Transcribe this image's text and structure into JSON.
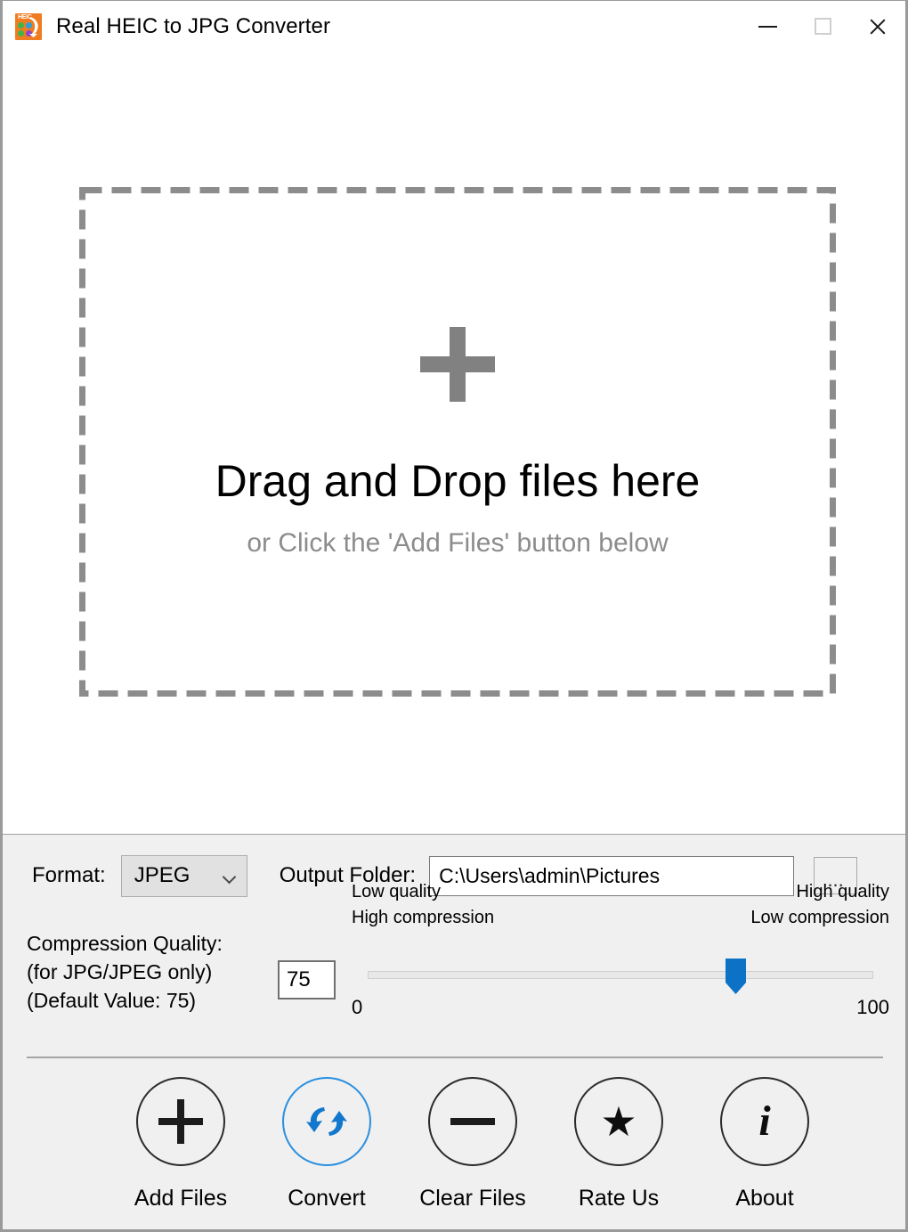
{
  "window": {
    "title": "Real HEIC to JPG Converter",
    "icon": "heic-app-icon",
    "icon_text": "HEIC",
    "controls": {
      "minimize": "minimize-icon",
      "maximize": "maximize-icon",
      "close": "close-icon"
    }
  },
  "dropzone": {
    "plus_icon": "plus-icon",
    "title": "Drag and Drop files here",
    "subtitle": "or Click the 'Add Files' button below"
  },
  "settings": {
    "format_label": "Format:",
    "format_value": "JPEG",
    "format_options": [
      "JPEG"
    ],
    "output_label": "Output Folder:",
    "output_path": "C:\\Users\\admin\\Pictures",
    "browse_label": "...",
    "quality_label_line1": "Compression Quality:",
    "quality_label_line2": "(for JPG/JPEG only)",
    "quality_label_line3": "(Default Value: 75)",
    "quality_value": "75",
    "slider": {
      "left_caption_line1": "Low quality",
      "left_caption_line2": "High compression",
      "right_caption_line1": "High quality",
      "right_caption_line2": "Low compression",
      "min_label": "0",
      "max_label": "100",
      "min": 0,
      "max": 100,
      "value": 75,
      "thumb_color": "#0c72c6"
    }
  },
  "actions": [
    {
      "label": "Add Files",
      "icon": "plus-icon",
      "accent": false
    },
    {
      "label": "Convert",
      "icon": "convert-icon",
      "accent": true
    },
    {
      "label": "Clear Files",
      "icon": "minus-icon",
      "accent": false
    },
    {
      "label": "Rate Us",
      "icon": "star-icon",
      "accent": false
    },
    {
      "label": "About",
      "icon": "info-icon",
      "accent": false
    }
  ],
  "colors": {
    "accent": "#2a8fe0",
    "brand_orange": "#f07c22",
    "panel_bg": "#f0f0f0",
    "dashed_border": "#8c8c8c",
    "muted_text": "#8c8c8c"
  }
}
